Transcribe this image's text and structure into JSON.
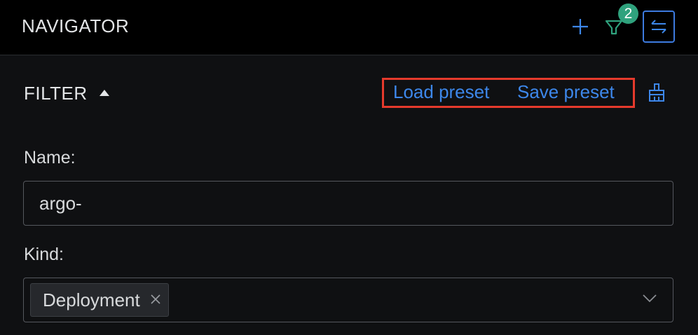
{
  "header": {
    "title": "NAVIGATOR",
    "filter_badge_count": "2"
  },
  "filter": {
    "heading": "FILTER",
    "load_preset_label": "Load preset",
    "save_preset_label": "Save preset"
  },
  "fields": {
    "name_label": "Name:",
    "name_value": "argo-",
    "kind_label": "Kind:",
    "kind_chips": [
      "Deployment"
    ]
  },
  "colors": {
    "accent": "#3d87ea",
    "badge": "#2fa27d",
    "highlight_box": "#e53a2c",
    "background": "#0f1012",
    "header_background": "#000000"
  },
  "icons": {
    "add": "plus-icon",
    "filter": "funnel-icon",
    "toggle": "swap-arrows-icon",
    "clear_filter": "broom-icon",
    "collapse": "caret-up-icon",
    "chip_remove": "close-icon",
    "dropdown": "chevron-down-icon"
  }
}
